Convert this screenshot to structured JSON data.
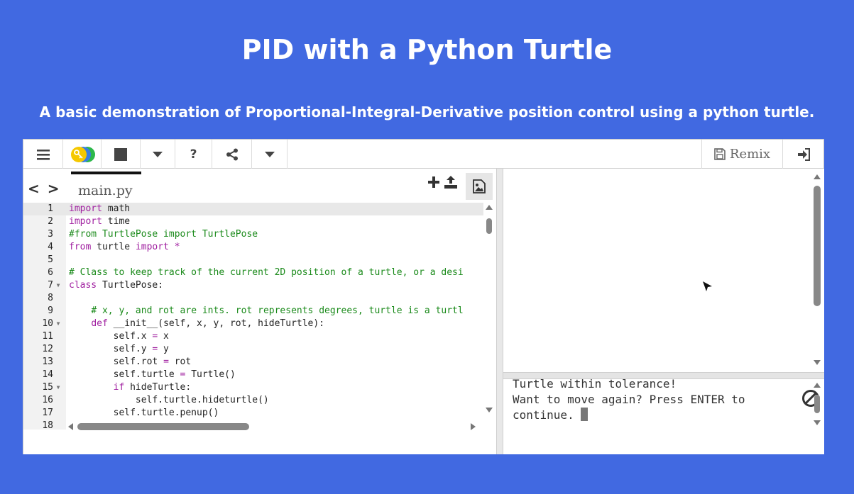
{
  "page": {
    "title": "PID with a Python Turtle",
    "subtitle": "A basic demonstration of Proportional-Integral-Derivative position control using a python turtle."
  },
  "toolbar": {
    "menu_icon": "hamburger-icon",
    "key_icon": "key-icon",
    "stop_icon": "stop-icon",
    "help_label": "?",
    "share_icon": "share-icon",
    "remix_label": "Remix",
    "login_icon": "sign-in-icon"
  },
  "editor": {
    "file_tab": "main.py",
    "lines": [
      {
        "n": "1",
        "fold": false
      },
      {
        "n": "2",
        "fold": false
      },
      {
        "n": "3",
        "fold": false
      },
      {
        "n": "4",
        "fold": false
      },
      {
        "n": "5",
        "fold": false
      },
      {
        "n": "6",
        "fold": false
      },
      {
        "n": "7",
        "fold": true
      },
      {
        "n": "8",
        "fold": false
      },
      {
        "n": "9",
        "fold": false
      },
      {
        "n": "10",
        "fold": true
      },
      {
        "n": "11",
        "fold": false
      },
      {
        "n": "12",
        "fold": false
      },
      {
        "n": "13",
        "fold": false
      },
      {
        "n": "14",
        "fold": false
      },
      {
        "n": "15",
        "fold": true
      },
      {
        "n": "16",
        "fold": false
      },
      {
        "n": "17",
        "fold": false
      },
      {
        "n": "18",
        "fold": false
      }
    ],
    "code": [
      "import math",
      "import time",
      "#from TurtlePose import TurtlePose",
      "from turtle import *",
      "",
      "# Class to keep track of the current 2D position of a turtle, or a desi",
      "class TurtlePose:",
      "",
      "    # x, y, and rot are ints. rot represents degrees, turtle is a turtl",
      "    def __init__(self, x, y, rot, hideTurtle):",
      "        self.x = x",
      "        self.y = y",
      "        self.rot = rot",
      "        self.turtle = Turtle()",
      "        if hideTurtle:",
      "            self.turtle.hideturtle()",
      "        self.turtle.penup()",
      ""
    ]
  },
  "console": {
    "output": "Turtle within tolerance!\nWant to move again? Press ENTER to\ncontinue. "
  },
  "colors": {
    "background": "#4169e1",
    "keyword": "#a020a0",
    "comment": "#1a8a1a"
  }
}
